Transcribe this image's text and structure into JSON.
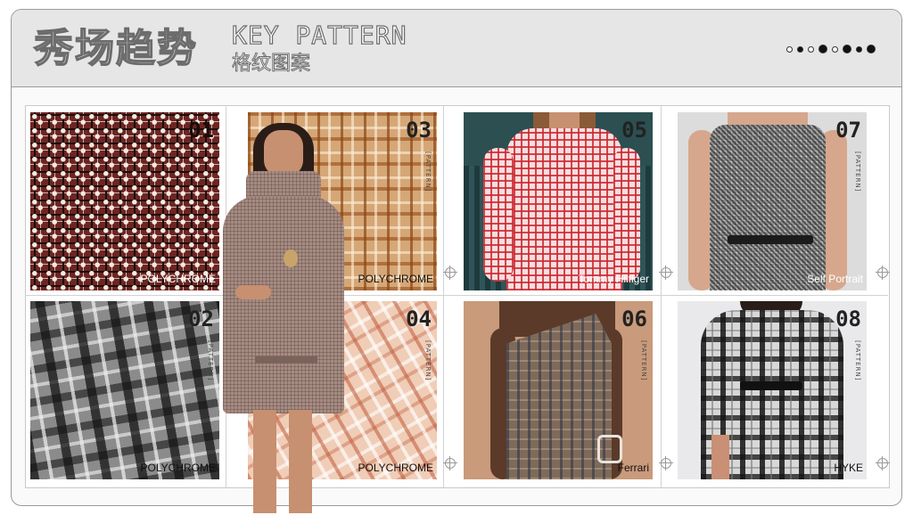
{
  "header": {
    "title_cn": "秀场趋势",
    "title_en": "KEY PATTERN",
    "subtitle_cn": "格纹图案"
  },
  "pagination": {
    "total": 8,
    "filled": [
      2,
      4,
      6,
      7,
      8
    ],
    "large": [
      4,
      6,
      8
    ]
  },
  "colors": {
    "header_bg": "#e6e6e6",
    "frame_border": "#9a9a9a",
    "text_dark": "#222222"
  },
  "vertical_tag": "[PATTERN]",
  "cells": [
    {
      "num": "01",
      "brand": "POLYCHROME",
      "kind": "fabric",
      "pattern": "red-dot-check"
    },
    {
      "num": "02",
      "brand": "POLYCHROME",
      "kind": "fabric",
      "pattern": "grey-plaid"
    },
    {
      "num": "03",
      "brand": "POLYCHROME",
      "kind": "fabric",
      "pattern": "tan-plaid"
    },
    {
      "num": "04",
      "brand": "POLYCHROME",
      "kind": "fabric",
      "pattern": "pink-plaid"
    },
    {
      "num": "05",
      "brand": "Tommy Hilfiger",
      "kind": "runway-photo",
      "pattern": "red-gingham-shirt"
    },
    {
      "num": "06",
      "brand": "Ferrari",
      "kind": "runway-photo",
      "pattern": "brown-plaid-dress"
    },
    {
      "num": "07",
      "brand": "Self Portrait",
      "kind": "runway-photo",
      "pattern": "houndstooth-dress"
    },
    {
      "num": "08",
      "brand": "HYKE",
      "kind": "runway-photo",
      "pattern": "bw-plaid-dress"
    }
  ],
  "overlay_model": {
    "outfit": "tweed-belted-coat-dress"
  }
}
